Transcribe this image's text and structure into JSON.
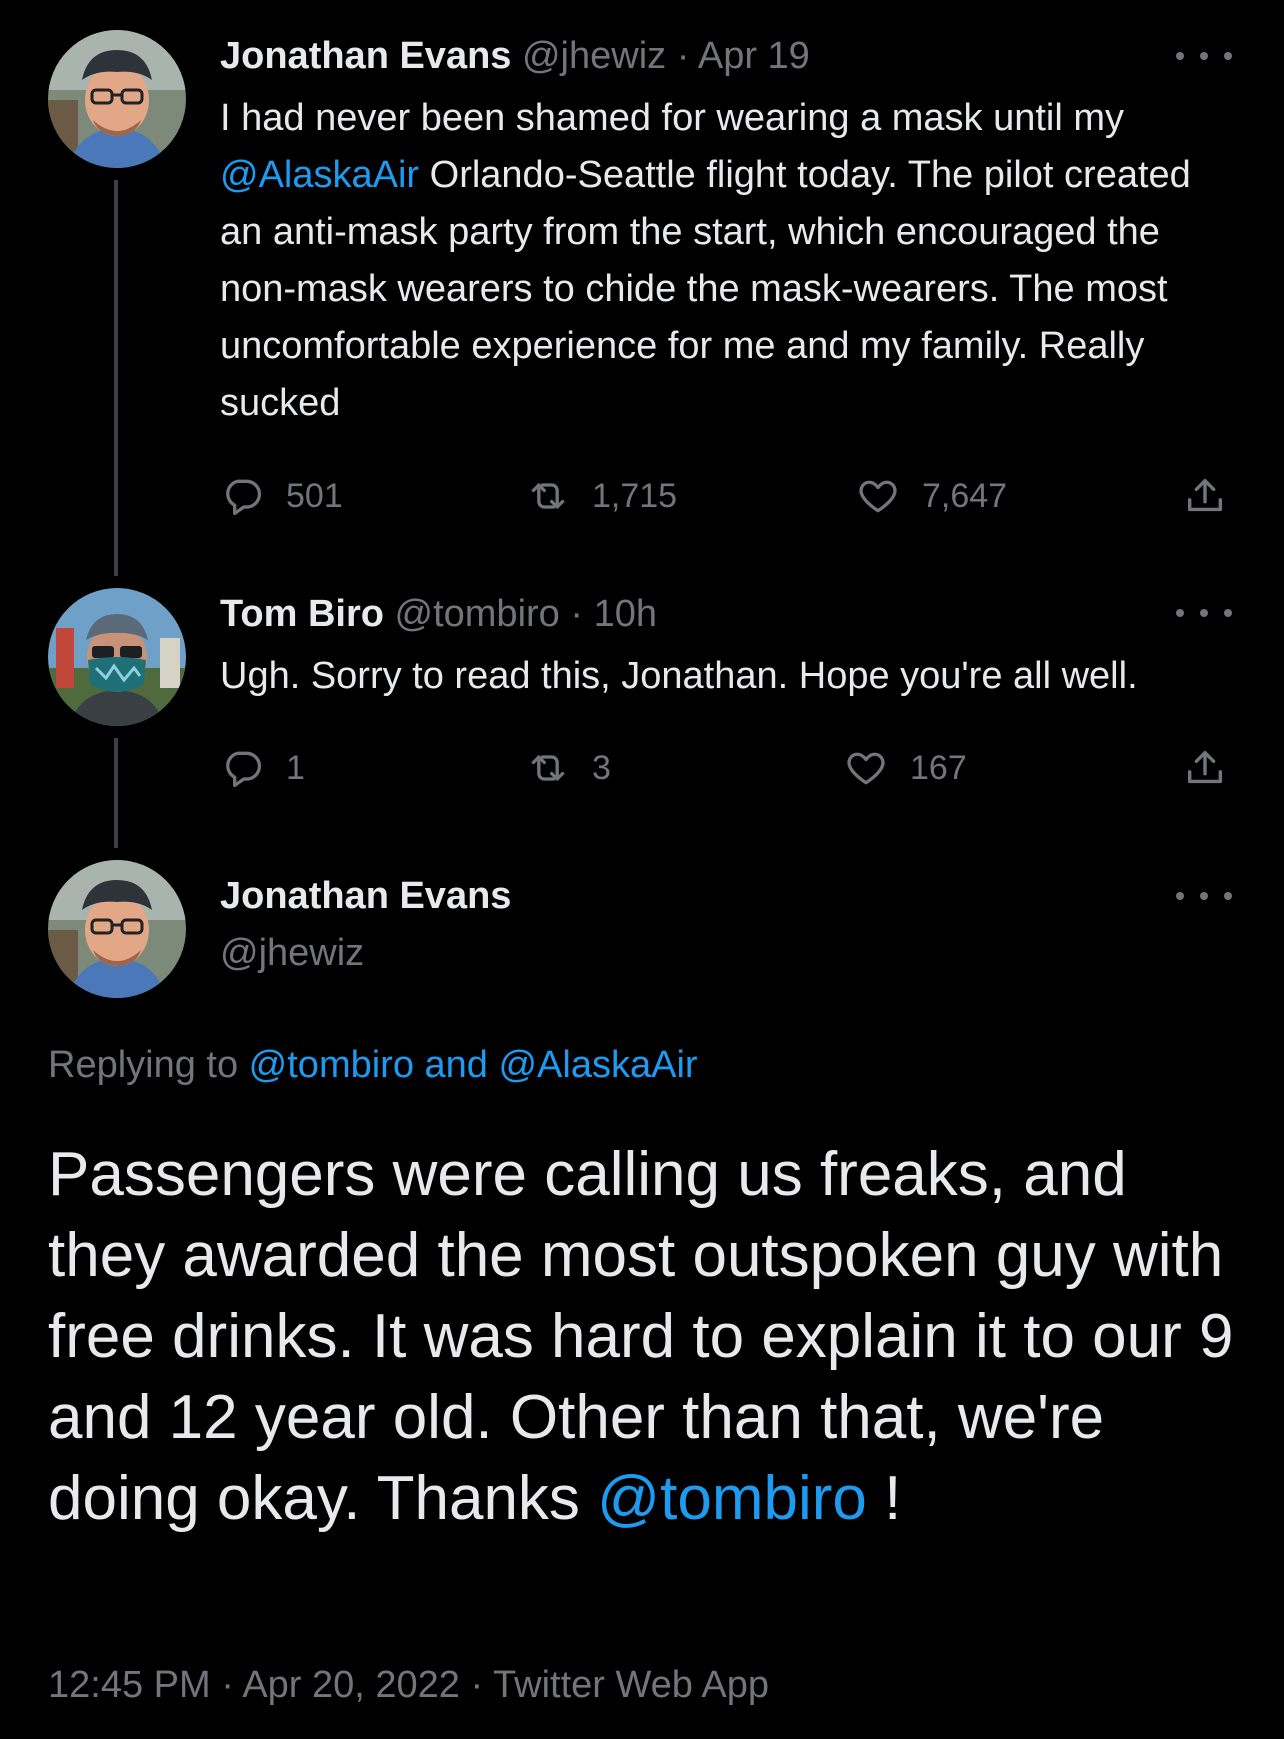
{
  "tweet1": {
    "name": "Jonathan Evans",
    "handle": "@jhewiz",
    "separator": "·",
    "time": "Apr 19",
    "text_before": "I had never been shamed for wearing a mask until my ",
    "mention": "@AlaskaAir",
    "text_after": " Orlando-Seattle flight today. The pilot created an anti-mask party from the start, which encouraged the non-mask wearers to chide the mask-wearers. The most uncomfortable experience for me and my family. Really sucked",
    "replies": "501",
    "retweets": "1,715",
    "likes": "7,647"
  },
  "tweet2": {
    "name": "Tom Biro",
    "handle": "@tombiro",
    "separator": "·",
    "time": "10h",
    "text": "Ugh. Sorry to read this, Jonathan. Hope you're all well.",
    "replies": "1",
    "retweets": "3",
    "likes": "167"
  },
  "focal": {
    "name": "Jonathan Evans",
    "handle": "@jhewiz",
    "replying_prefix": "Replying to ",
    "replying_to": "@tombiro and @AlaskaAir",
    "text": "Passengers were calling us freaks, and they awarded the most outspoken guy with free drinks. It was hard to explain it to our 9 and 12 year old. Other than that, we're doing okay. Thanks ",
    "mention": "@tombiro",
    "text_end": " !",
    "timestamp": "12:45 PM · Apr 20, 2022 · Twitter Web App"
  },
  "icons": {
    "reply": "reply-icon",
    "retweet": "retweet-icon",
    "like": "like-icon",
    "share": "share-icon",
    "more": "more-icon"
  },
  "colors": {
    "background": "#000000",
    "text": "#e7e9ea",
    "muted": "#71767b",
    "link": "#1d9bf0",
    "thread_line": "#3e4144"
  }
}
